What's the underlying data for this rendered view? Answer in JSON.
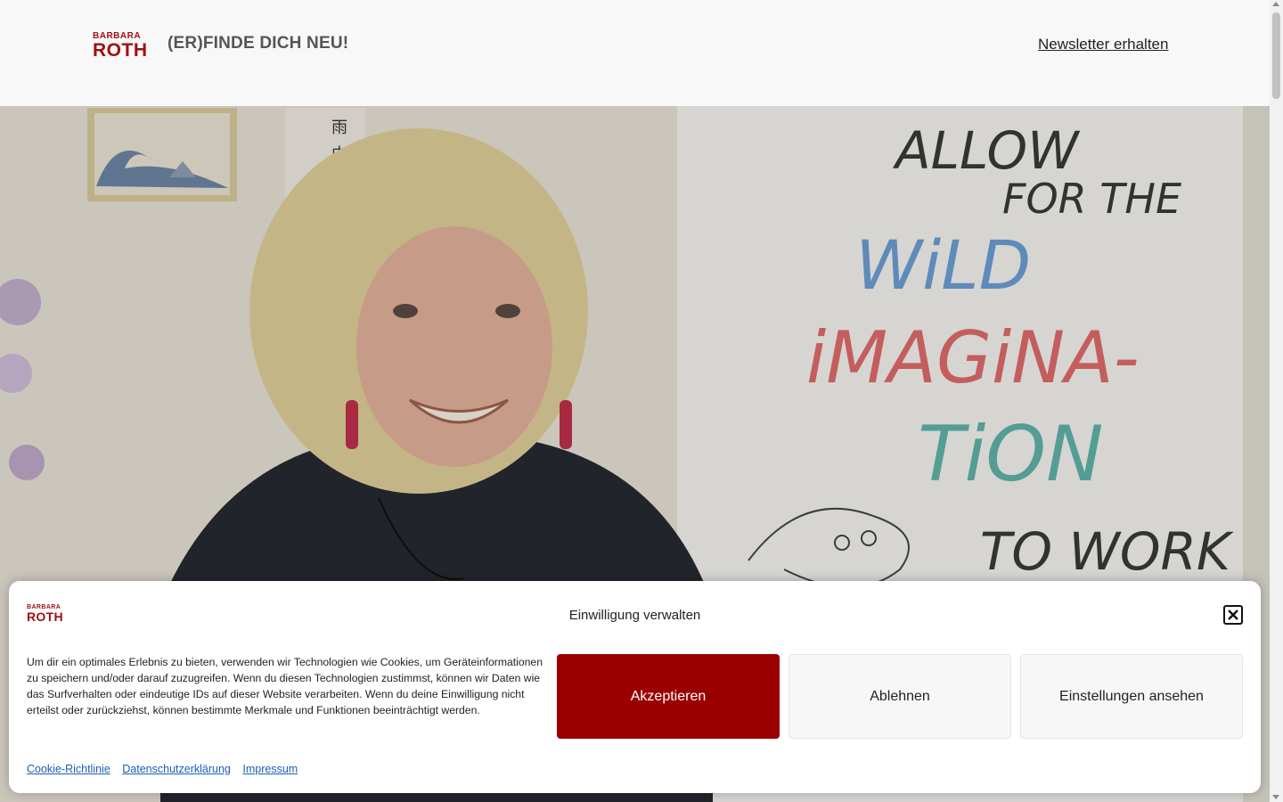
{
  "header": {
    "logo_top": "BARBARA",
    "logo_bottom": "ROTH",
    "tagline": "(ER)FINDE DICH NEU!",
    "newsletter_link": "Newsletter erhalten"
  },
  "hero": {
    "board_lines": [
      "ALLOW",
      "FOR THE",
      "WiLD",
      "iMAGiNA-",
      "TiON",
      "TO WORK"
    ]
  },
  "cookie_banner": {
    "logo_top": "BARBARA",
    "logo_bottom": "ROTH",
    "title": "Einwilligung verwalten",
    "close_icon": "close-icon",
    "text": "Um dir ein optimales Erlebnis zu bieten, verwenden wir Technologien wie Cookies, um Geräteinformationen zu speichern und/oder darauf zuzugreifen. Wenn du diesen Technologien zustimmst, können wir Daten wie das Surfverhalten oder eindeutige IDs auf dieser Website verarbeiten. Wenn du deine Einwilligung nicht erteilst oder zurückziehst, können bestimmte Merkmale und Funktionen beeinträchtigt werden.",
    "buttons": {
      "accept": "Akzeptieren",
      "deny": "Ablehnen",
      "settings": "Einstellungen ansehen"
    },
    "links": {
      "cookie_policy": "Cookie-Richtlinie",
      "privacy": "Datenschutzerklärung",
      "imprint": "Impressum"
    }
  },
  "colors": {
    "brand_red": "#9a0000",
    "header_bg": "#f8f8f8",
    "link_blue": "#1a5fb4"
  }
}
